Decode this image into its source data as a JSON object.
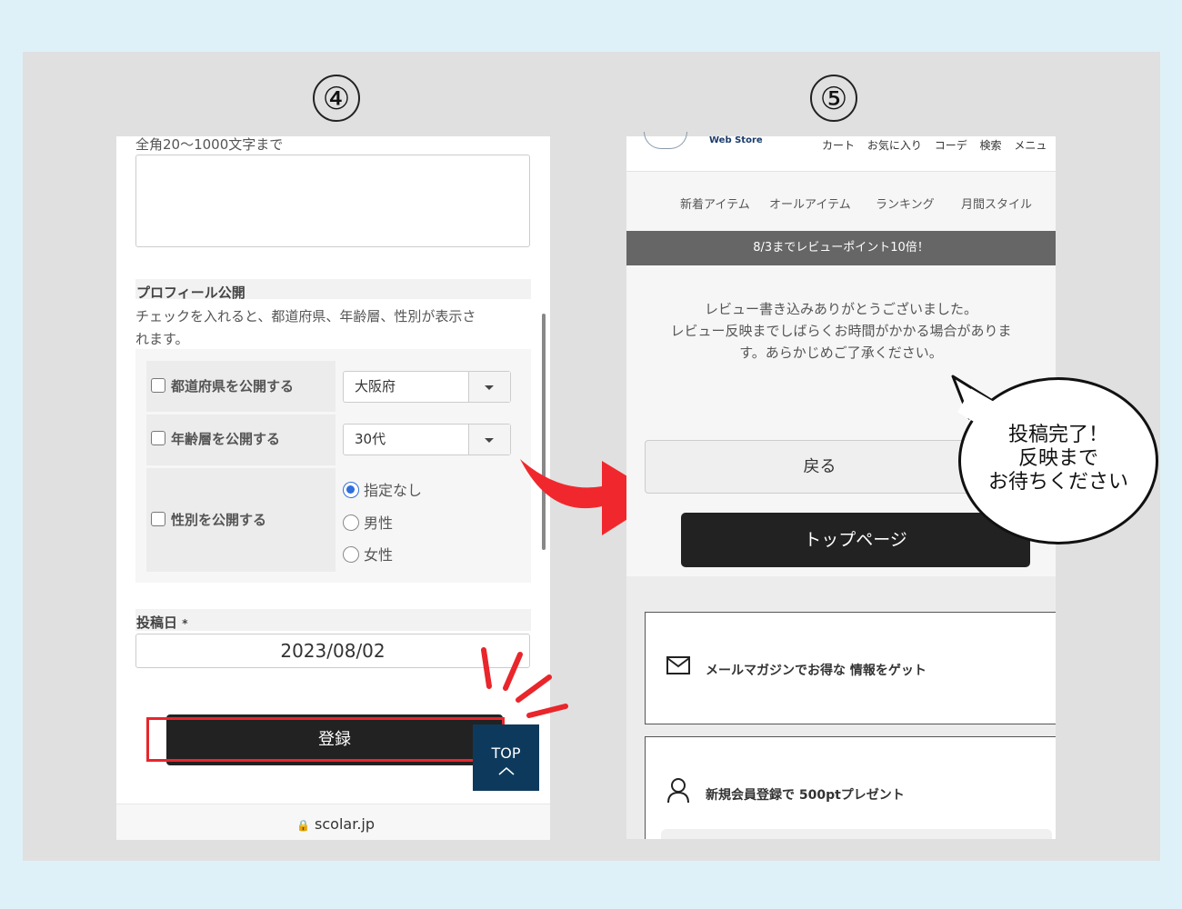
{
  "steps": {
    "left": "④",
    "right": "⑤"
  },
  "screen4": {
    "char_limit_note": "全角20〜1000文字まで",
    "profile_title": "プロフィール公開",
    "profile_desc_line1": "チェックを入れると、都道府県、年齢層、性別が表示さ",
    "profile_desc_line2": "れます。",
    "prefecture_label": "都道府県を公開する",
    "prefecture_value": "大阪府",
    "age_label": "年齢層を公開する",
    "age_value": "30代",
    "gender_label": "性別を公開する",
    "gender_options": [
      "指定なし",
      "男性",
      "女性"
    ],
    "gender_selected": "指定なし",
    "post_date_label": "投稿日",
    "required_mark": "*",
    "post_date_value": "2023/08/02",
    "submit_label": "登録",
    "top_label": "TOP",
    "url": "scolar.jp"
  },
  "screen5": {
    "logo_text": "Web Store",
    "header_links": [
      "カート",
      "お気に入り",
      "コーデ",
      "検索",
      "メニュ"
    ],
    "nav_items": [
      "新着アイテム",
      "オールアイテム",
      "ランキング",
      "月間スタイル"
    ],
    "banner": "8/3までレビューポイント10倍！",
    "thanks_line1": "レビュー書き込みありがとうございました。",
    "thanks_line2": "レビュー反映までしばらくお時間がかかる場合がありま",
    "thanks_line3": "す。あらかじめご了承ください。",
    "back_label": "戻る",
    "toppage_label": "トップページ",
    "newsletter_text": "メールマガジンでお得な 情報をゲット",
    "signup_text": "新規会員登録で 500ptプレゼント"
  },
  "callout": {
    "line1": "投稿完了！",
    "line2": "反映まで",
    "line3": "お待ちください"
  },
  "colors": {
    "highlight_red": "#e8262b",
    "arrow_red": "#f0282d",
    "top_button_bg": "#0d3a5c",
    "banner_bg": "#666666"
  }
}
